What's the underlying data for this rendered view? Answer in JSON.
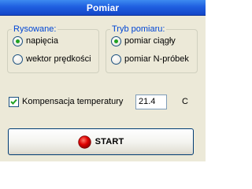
{
  "window": {
    "title": "Pomiar"
  },
  "rysowane": {
    "legend": "Rysowane:",
    "options": [
      {
        "label": "napięcia",
        "checked": true
      },
      {
        "label": "wektor prędkości",
        "checked": false
      }
    ]
  },
  "tryb": {
    "legend": "Tryb pomiaru:",
    "options": [
      {
        "label": "pomiar ciągły",
        "checked": true
      },
      {
        "label": "pomiar N-próbek",
        "checked": false
      }
    ]
  },
  "kompensacja": {
    "label": "Kompensacja temperatury",
    "checked": true,
    "value": "21.4",
    "unit": "C"
  },
  "start_button": {
    "label": "START",
    "icon": "red-circle-icon"
  },
  "colors": {
    "title_bar": "#1F5FE0",
    "group_legend": "#0046D5",
    "radio_dot": "#21A121",
    "start_icon": "#E00000",
    "window_bg": "#ECE9D8"
  }
}
